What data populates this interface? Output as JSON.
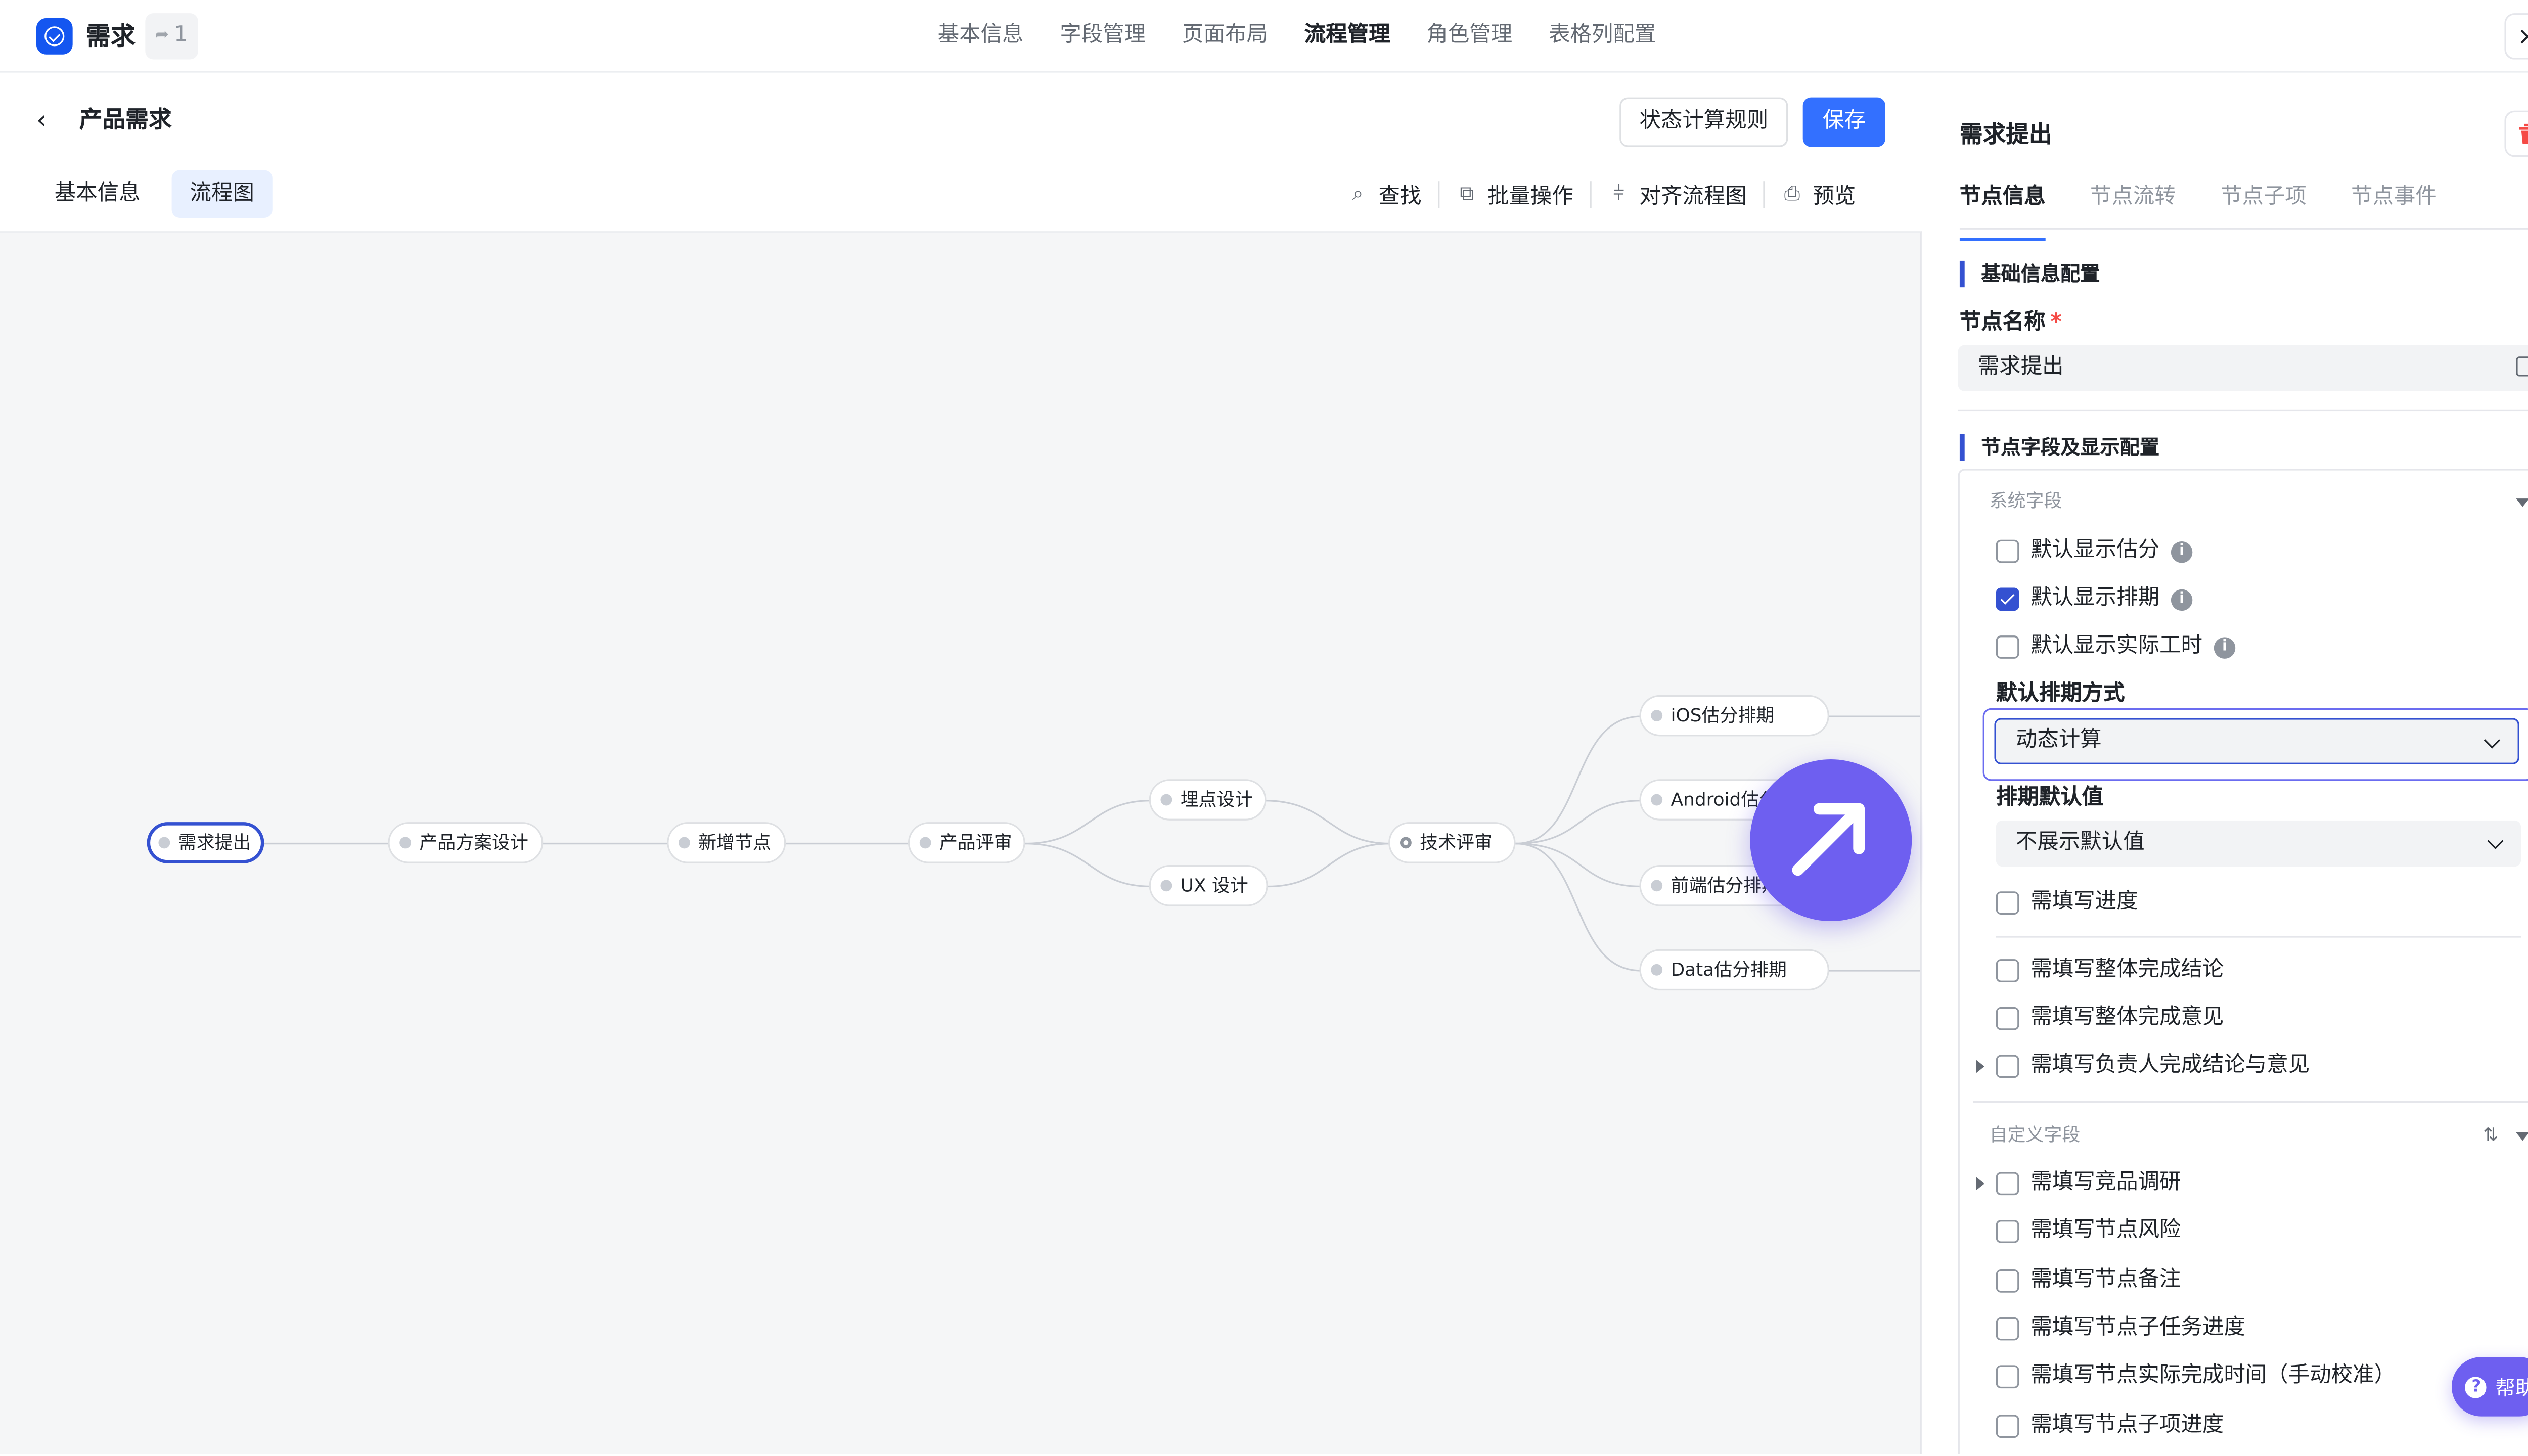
{
  "header": {
    "app_title": "需求",
    "count": "1",
    "tabs": [
      {
        "label": "基本信息"
      },
      {
        "label": "字段管理"
      },
      {
        "label": "页面布局"
      },
      {
        "label": "流程管理"
      },
      {
        "label": "角色管理"
      },
      {
        "label": "表格列配置"
      }
    ],
    "active_tab": "流程管理",
    "close_icon": "×"
  },
  "editor": {
    "title": "产品需求",
    "rules_button": "状态计算规则",
    "save_button": "保存",
    "sub_tabs": [
      {
        "label": "基本信息"
      },
      {
        "label": "流程图"
      }
    ],
    "active_sub_tab": "流程图",
    "toolbar": {
      "find": "查找",
      "batch": "批量操作",
      "align": "对齐流程图",
      "preview": "预览"
    }
  },
  "flow": {
    "nodes": [
      {
        "label": "需求提出",
        "selected": true
      },
      {
        "label": "产品方案设计"
      },
      {
        "label": "新增节点"
      },
      {
        "label": "产品评审"
      },
      {
        "label": "埋点设计"
      },
      {
        "label": "UX 设计"
      },
      {
        "label": "技术评审"
      },
      {
        "label": "iOS估分排期"
      },
      {
        "label": "Android估分排期"
      },
      {
        "label": "前端估分排期"
      },
      {
        "label": "Data估分排期"
      }
    ],
    "floating_button_icon": "arrow-up-right-icon"
  },
  "panel": {
    "title": "需求提出",
    "tabs": [
      {
        "label": "节点信息"
      },
      {
        "label": "节点流转"
      },
      {
        "label": "节点子项"
      },
      {
        "label": "节点事件"
      }
    ],
    "active_tab": "节点信息",
    "basic_section": "基础信息配置",
    "name_label": "节点名称",
    "required_mark": "*",
    "name_value": "需求提出",
    "fields_section": "节点字段及显示配置",
    "system_group": "系统字段",
    "system_fields": [
      {
        "label": "默认显示估分",
        "checked": false,
        "info": true
      },
      {
        "label": "默认显示排期",
        "checked": true,
        "info": true
      },
      {
        "label": "默认显示实际工时",
        "checked": false,
        "info": true
      }
    ],
    "schedule_mode_label": "默认排期方式",
    "schedule_mode_value": "动态计算",
    "schedule_default_label": "排期默认值",
    "schedule_default_value": "不展示默认值",
    "more_fields": [
      {
        "label": "需填写进度",
        "checked": false
      },
      {
        "label": "需填写整体完成结论",
        "checked": false
      },
      {
        "label": "需填写整体完成意见",
        "checked": false
      },
      {
        "label": "需填写负责人完成结论与意见",
        "checked": false,
        "expandable": true
      }
    ],
    "custom_group": "自定义字段",
    "custom_fields": [
      {
        "label": "需填写竞品调研",
        "checked": false,
        "expandable": true
      },
      {
        "label": "需填写节点风险",
        "checked": false
      },
      {
        "label": "需填写节点备注",
        "checked": false
      },
      {
        "label": "需填写节点子任务进度",
        "checked": false
      },
      {
        "label": "需填写节点实际完成时间（手动校准）",
        "checked": false
      },
      {
        "label": "需填写节点子项进度",
        "checked": false
      }
    ]
  },
  "help": {
    "label": "帮助"
  },
  "colors": {
    "primary": "#3370ff",
    "selected_border": "#3451d1",
    "fab": "#6e5ff0",
    "delete": "#f54a45"
  }
}
